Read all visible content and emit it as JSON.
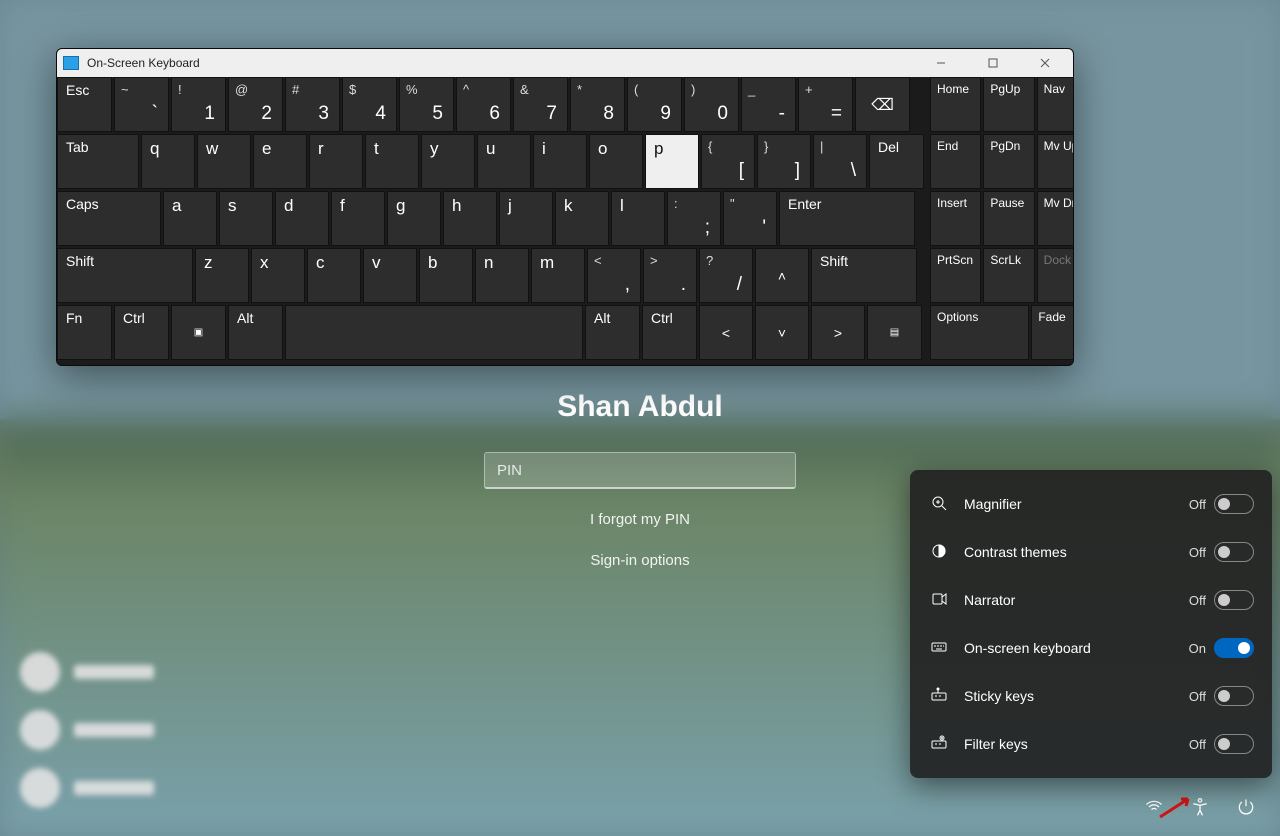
{
  "login": {
    "username": "Shan Abdul",
    "pin_placeholder": "PIN",
    "forgot": "I forgot my PIN",
    "signin_options": "Sign-in options"
  },
  "osk": {
    "title": "On-Screen Keyboard",
    "row1": {
      "esc": "Esc",
      "keys": [
        {
          "u": "~",
          "l": "`"
        },
        {
          "u": "!",
          "l": "1"
        },
        {
          "u": "@",
          "l": "2"
        },
        {
          "u": "#",
          "l": "3"
        },
        {
          "u": "$",
          "l": "4"
        },
        {
          "u": "%",
          "l": "5"
        },
        {
          "u": "^",
          "l": "6"
        },
        {
          "u": "&",
          "l": "7"
        },
        {
          "u": "*",
          "l": "8"
        },
        {
          "u": "(",
          "l": "9"
        },
        {
          "u": ")",
          "l": "0"
        },
        {
          "u": "_",
          "l": "-"
        },
        {
          "u": "+",
          "l": "="
        }
      ],
      "back": "⌫"
    },
    "row2": {
      "tab": "Tab",
      "keys": [
        "q",
        "w",
        "e",
        "r",
        "t",
        "y",
        "u",
        "i",
        "o",
        "p"
      ],
      "brackets": [
        {
          "u": "{",
          "l": "["
        },
        {
          "u": "}",
          "l": "]"
        },
        {
          "u": "|",
          "l": "\\"
        }
      ],
      "del": "Del"
    },
    "row3": {
      "caps": "Caps",
      "keys": [
        "a",
        "s",
        "d",
        "f",
        "g",
        "h",
        "j",
        "k",
        "l"
      ],
      "punct": [
        {
          "u": ":",
          "l": ";"
        },
        {
          "u": "\"",
          "l": "'"
        }
      ],
      "enter": "Enter"
    },
    "row4": {
      "shiftL": "Shift",
      "keys": [
        "z",
        "x",
        "c",
        "v",
        "b",
        "n",
        "m"
      ],
      "punct": [
        {
          "u": "<",
          "l": ","
        },
        {
          "u": ">",
          "l": "."
        },
        {
          "u": "?",
          "l": "/"
        }
      ],
      "up": "˄",
      "shiftR": "Shift"
    },
    "row5": {
      "fn": "Fn",
      "ctrlL": "Ctrl",
      "win": "⊞",
      "altL": "Alt",
      "space": "",
      "altR": "Alt",
      "ctrlR": "Ctrl",
      "left": "˂",
      "down": "˅",
      "right": "˃",
      "menu": "▤"
    },
    "side": [
      [
        "Home",
        "PgUp",
        "Nav"
      ],
      [
        "End",
        "PgDn",
        "Mv Up"
      ],
      [
        "Insert",
        "Pause",
        "Mv Dn"
      ],
      [
        "PrtScn",
        "ScrLk",
        "Dock"
      ],
      [
        "Options",
        "",
        "Fade"
      ]
    ]
  },
  "flyout": {
    "items": [
      {
        "label": "Magnifier",
        "state": "Off",
        "on": false
      },
      {
        "label": "Contrast themes",
        "state": "Off",
        "on": false
      },
      {
        "label": "Narrator",
        "state": "Off",
        "on": false
      },
      {
        "label": "On-screen keyboard",
        "state": "On",
        "on": true
      },
      {
        "label": "Sticky keys",
        "state": "Off",
        "on": false
      },
      {
        "label": "Filter keys",
        "state": "Off",
        "on": false
      }
    ]
  }
}
